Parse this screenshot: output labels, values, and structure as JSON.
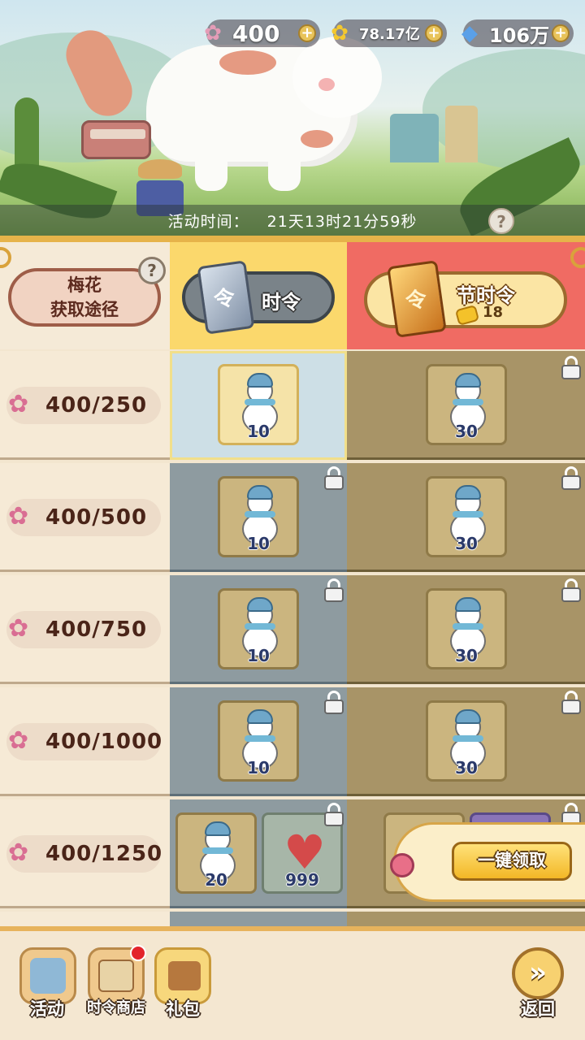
{
  "currencies": [
    {
      "icon": "plum-blossom-icon",
      "value": "400"
    },
    {
      "icon": "gold-flower-icon",
      "value": "78.17亿"
    },
    {
      "icon": "blue-gem-icon",
      "value": "106万"
    }
  ],
  "activity": {
    "label": "活动时间：",
    "remaining": "21天13时21分59秒"
  },
  "header": {
    "plum_line1": "梅花",
    "plum_line2": "获取途径",
    "pass_label": "时令",
    "festival_pass_label": "节时令",
    "festival_cost": "18"
  },
  "rows": [
    {
      "requirement": "400/250",
      "free_qty": "10",
      "premium_qty": "30"
    },
    {
      "requirement": "400/500",
      "free_qty": "10",
      "premium_qty": "30"
    },
    {
      "requirement": "400/750",
      "free_qty": "10",
      "premium_qty": "30"
    },
    {
      "requirement": "400/1000",
      "free_qty": "10",
      "premium_qty": "30"
    },
    {
      "requirement": "400/1250",
      "free_qty": "20",
      "free_qty2": "999"
    }
  ],
  "claim_all_label": "一键领取",
  "nav": {
    "activity": "活动",
    "shop": "时令商店",
    "gift": "礼包",
    "back": "返回"
  },
  "colors": {
    "accent_gold": "#e6b34a",
    "premium_red": "#f06b63",
    "pass_yellow": "#fbd86c"
  }
}
